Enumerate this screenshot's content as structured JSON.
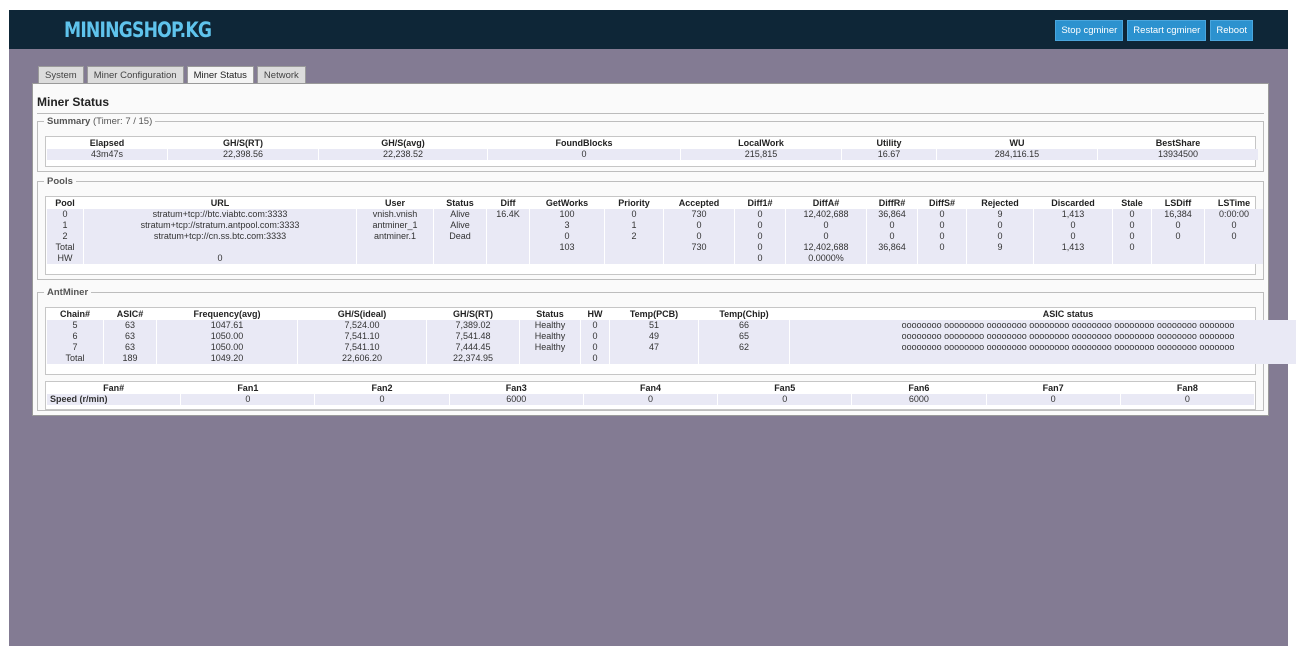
{
  "header": {
    "logo": "MININGSHOP.KG",
    "buttons": [
      "Stop cgminer",
      "Restart cgminer",
      "Reboot"
    ]
  },
  "tabs": [
    "System",
    "Miner Configuration",
    "Miner Status",
    "Network"
  ],
  "active_tab": "Miner Status",
  "page_title": "Miner Status",
  "summary": {
    "legend": "Summary",
    "timer": "(Timer: 7 / 15)",
    "headers": [
      "Elapsed",
      "GH/S(RT)",
      "GH/S(avg)",
      "FoundBlocks",
      "LocalWork",
      "Utility",
      "WU",
      "BestShare"
    ],
    "values": [
      "43m47s",
      "22,398.56",
      "22,238.52",
      "0",
      "215,815",
      "16.67",
      "284,116.15",
      "13934500"
    ]
  },
  "pools": {
    "legend": "Pools",
    "headers": [
      "Pool",
      "URL",
      "User",
      "Status",
      "Diff",
      "GetWorks",
      "Priority",
      "Accepted",
      "Diff1#",
      "DiffA#",
      "DiffR#",
      "DiffS#",
      "Rejected",
      "Discarded",
      "Stale",
      "LSDiff",
      "LSTime"
    ],
    "rows": [
      [
        "0",
        "stratum+tcp://btc.viabtc.com:3333",
        "vnish.vnish",
        "Alive",
        "16.4K",
        "100",
        "0",
        "730",
        "0",
        "12,402,688",
        "36,864",
        "0",
        "9",
        "1,413",
        "0",
        "16,384",
        "0:00:00"
      ],
      [
        "1",
        "stratum+tcp://stratum.antpool.com:3333",
        "antminer_1",
        "Alive",
        "",
        "3",
        "1",
        "0",
        "0",
        "0",
        "0",
        "0",
        "0",
        "0",
        "0",
        "0",
        "0"
      ],
      [
        "2",
        "stratum+tcp://cn.ss.btc.com:3333",
        "antminer.1",
        "Dead",
        "",
        "0",
        "2",
        "0",
        "0",
        "0",
        "0",
        "0",
        "0",
        "0",
        "0",
        "0",
        "0"
      ],
      [
        "Total",
        "",
        "",
        "",
        "",
        "103",
        "",
        "730",
        "0",
        "12,402,688",
        "36,864",
        "0",
        "9",
        "1,413",
        "0",
        "",
        ""
      ],
      [
        "HW",
        "0",
        "",
        "",
        "",
        "",
        "",
        "",
        "0",
        "0.0000%",
        "",
        "",
        "",
        "",
        "",
        "",
        ""
      ]
    ]
  },
  "antminer": {
    "legend": "AntMiner",
    "headers": [
      "Chain#",
      "ASIC#",
      "Frequency(avg)",
      "GH/S(ideal)",
      "GH/S(RT)",
      "Status",
      "HW",
      "Temp(PCB)",
      "Temp(Chip)",
      "ASIC status"
    ],
    "rows": [
      [
        "5",
        "63",
        "1047.61",
        "7,524.00",
        "7,389.02",
        "Healthy",
        "0",
        "51",
        "66",
        "oooooooo oooooooo oooooooo oooooooo oooooooo oooooooo oooooooo ooooooo"
      ],
      [
        "6",
        "63",
        "1050.00",
        "7,541.10",
        "7,541.48",
        "Healthy",
        "0",
        "49",
        "65",
        "oooooooo oooooooo oooooooo oooooooo oooooooo oooooooo oooooooo ooooooo"
      ],
      [
        "7",
        "63",
        "1050.00",
        "7,541.10",
        "7,444.45",
        "Healthy",
        "0",
        "47",
        "62",
        "oooooooo oooooooo oooooooo oooooooo oooooooo oooooooo oooooooo ooooooo"
      ],
      [
        "Total",
        "189",
        "1049.20",
        "22,606.20",
        "22,374.95",
        "",
        "0",
        "",
        "",
        ""
      ]
    ],
    "fans": {
      "headers": [
        "Fan#",
        "Fan1",
        "Fan2",
        "Fan3",
        "Fan4",
        "Fan5",
        "Fan6",
        "Fan7",
        "Fan8"
      ],
      "speed": [
        "Speed (r/min)",
        "0",
        "0",
        "6000",
        "0",
        "0",
        "6000",
        "0",
        "0"
      ]
    }
  }
}
